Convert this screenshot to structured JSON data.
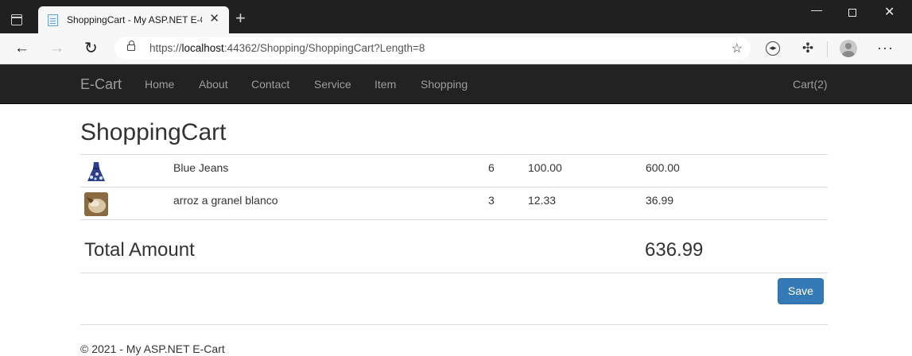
{
  "browser": {
    "tab_title": "ShoppingCart - My ASP.NET E-Ca",
    "url_prefix": "https://",
    "url_host": "localhost",
    "url_rest": ":44362/Shopping/ShoppingCart?Length=8"
  },
  "navbar": {
    "brand": "E-Cart",
    "links": [
      "Home",
      "About",
      "Contact",
      "Service",
      "Item",
      "Shopping"
    ],
    "cart": "Cart(2)"
  },
  "page": {
    "title": "ShoppingCart",
    "items": [
      {
        "image": "blue-dress-image",
        "name": "Blue Jeans",
        "qty": "6",
        "price": "100.00",
        "amount": "600.00"
      },
      {
        "image": "rice-product-image",
        "name": "arroz a granel blanco",
        "qty": "3",
        "price": "12.33",
        "amount": "36.99"
      }
    ],
    "total_label": "Total Amount",
    "total_value": "636.99",
    "save_label": "Save",
    "footer": "© 2021 - My ASP.NET E-Cart"
  }
}
